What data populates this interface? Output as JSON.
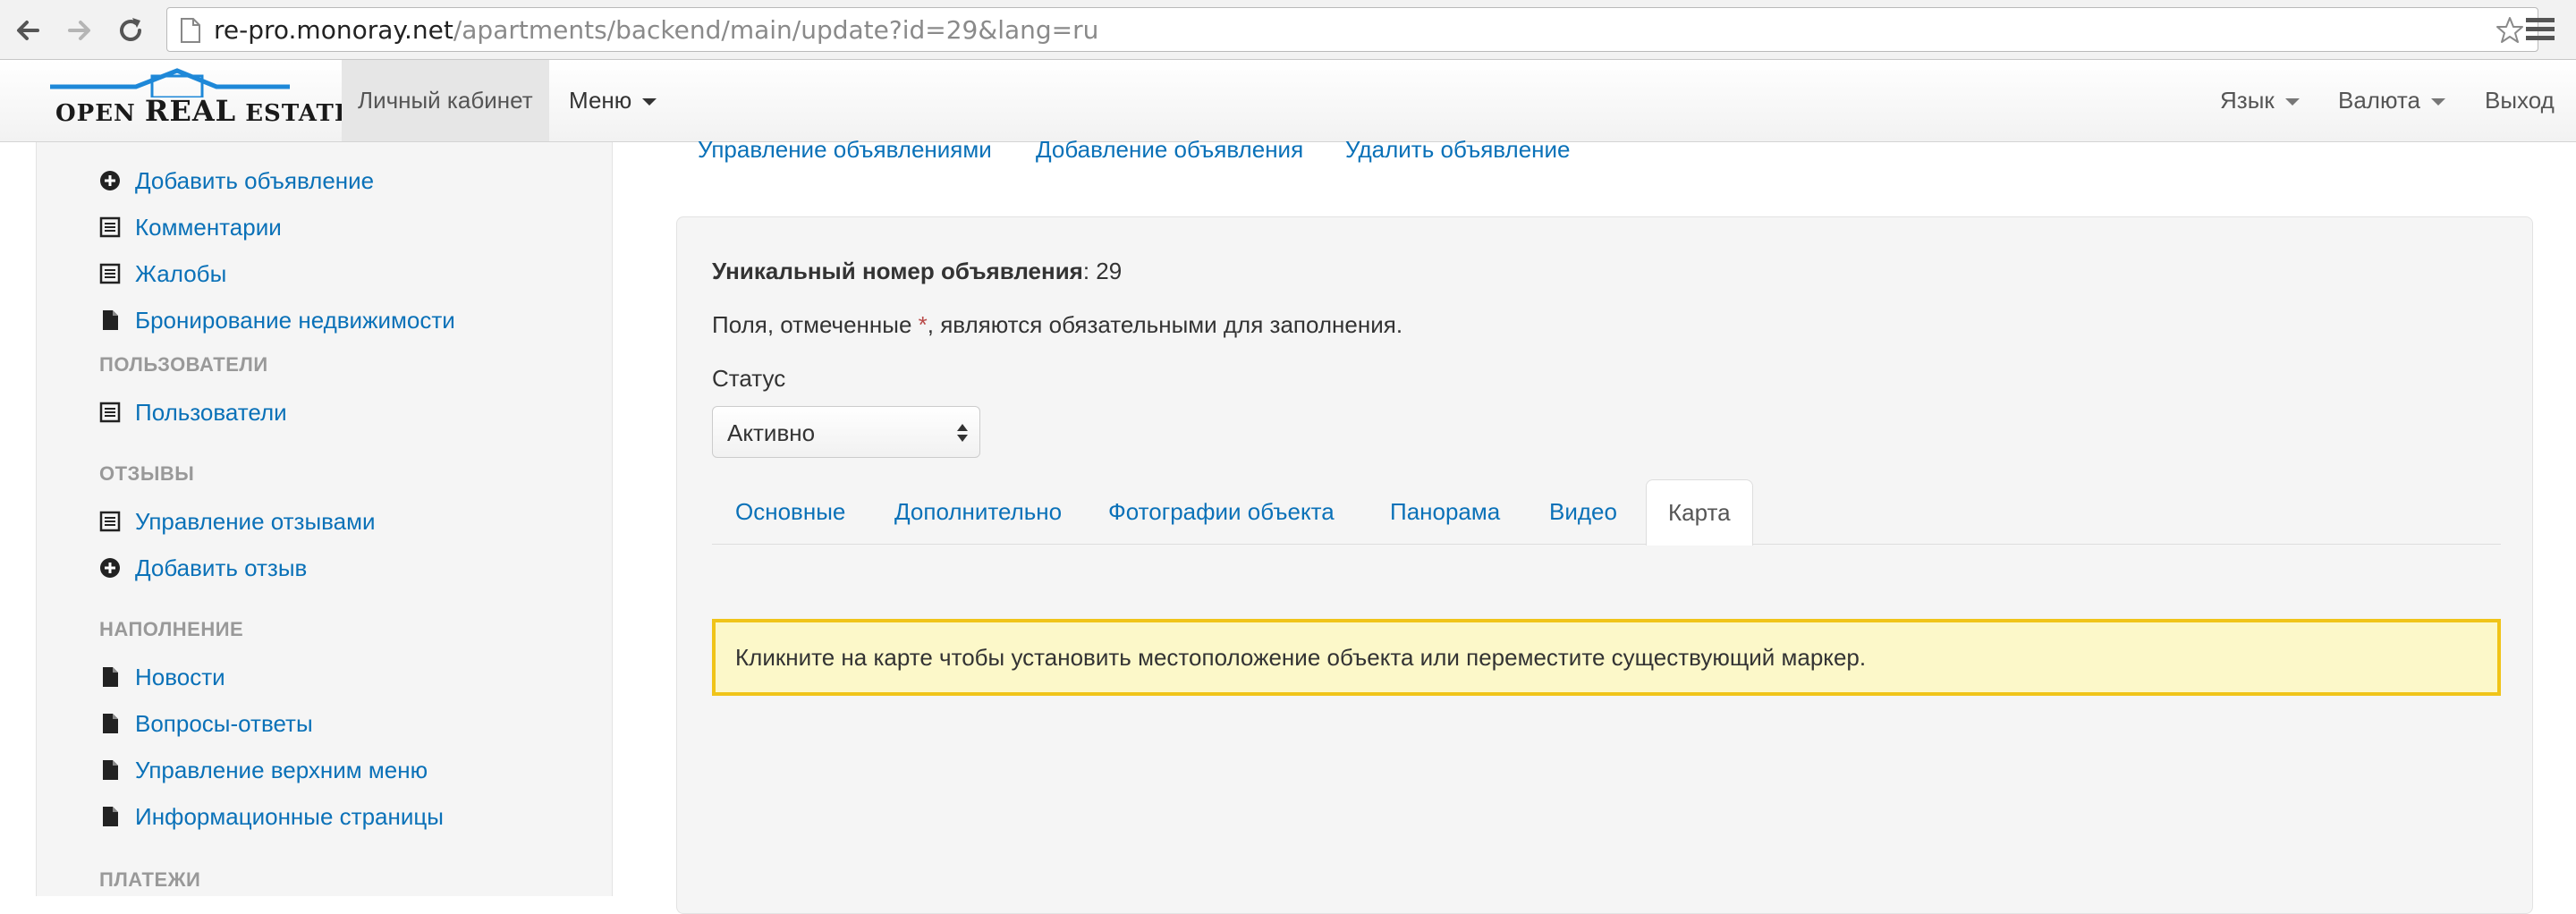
{
  "browser": {
    "url_host": "re-pro.monoray.net",
    "url_path": "/apartments/backend/main/update?id=29&lang=ru",
    "icons": [
      "back-arrow-icon",
      "forward-arrow-icon",
      "reload-icon",
      "page-icon",
      "star-icon",
      "menu-icon"
    ]
  },
  "navbar": {
    "logo": {
      "word1": "OPEN",
      "word2": "REAL",
      "word3": "ESTATE"
    },
    "cabinet": "Личный кабинет",
    "menu": "Меню",
    "language": "Язык",
    "currency": "Валюта",
    "logout": "Выход"
  },
  "sidebar": {
    "items_top": [
      {
        "label": "Добавить объявление",
        "icon": "plus-circle-icon"
      },
      {
        "label": "Комментарии",
        "icon": "list-icon"
      },
      {
        "label": "Жалобы",
        "icon": "list-icon"
      },
      {
        "label": "Бронирование недвижимости",
        "icon": "file-icon"
      }
    ],
    "section_users": "ПОЛЬЗОВАТЕЛИ",
    "users_items": [
      {
        "label": "Пользователи",
        "icon": "list-icon"
      }
    ],
    "section_reviews": "ОТЗЫВЫ",
    "reviews_items": [
      {
        "label": "Управление отзывами",
        "icon": "list-icon"
      },
      {
        "label": "Добавить отзыв",
        "icon": "plus-circle-icon"
      }
    ],
    "section_content": "НАПОЛНЕНИЕ",
    "content_items": [
      {
        "label": "Новости",
        "icon": "file-icon"
      },
      {
        "label": "Вопросы-ответы",
        "icon": "file-icon"
      },
      {
        "label": "Управление верхним меню",
        "icon": "file-icon"
      },
      {
        "label": "Информационные страницы",
        "icon": "file-icon"
      }
    ],
    "section_payments": "ПЛАТЕЖИ"
  },
  "main": {
    "top_links": [
      "Управление объявлениями",
      "Добавление объявления",
      "Удалить объявление"
    ],
    "unique_label": "Уникальный номер объявления",
    "unique_value": ": 29",
    "required_prefix": "Поля, отмеченные ",
    "required_star": "*",
    "required_suffix": ", являются обязательными для заполнения.",
    "status_label": "Статус",
    "status_value": "Активно",
    "tabs": [
      "Основные",
      "Дополнительно",
      "Фотографии объекта",
      "Панорама",
      "Видео",
      "Карта"
    ],
    "active_tab": "Карта",
    "alert": "Кликните на карте чтобы установить местоположение объекта или переместите существующий маркер."
  },
  "colors": {
    "link": "#0a71b8",
    "alert_bg": "#fcf8c9",
    "alert_border": "#f0c419",
    "logo_roof": "#1e88d8",
    "required": "#b94a48"
  }
}
